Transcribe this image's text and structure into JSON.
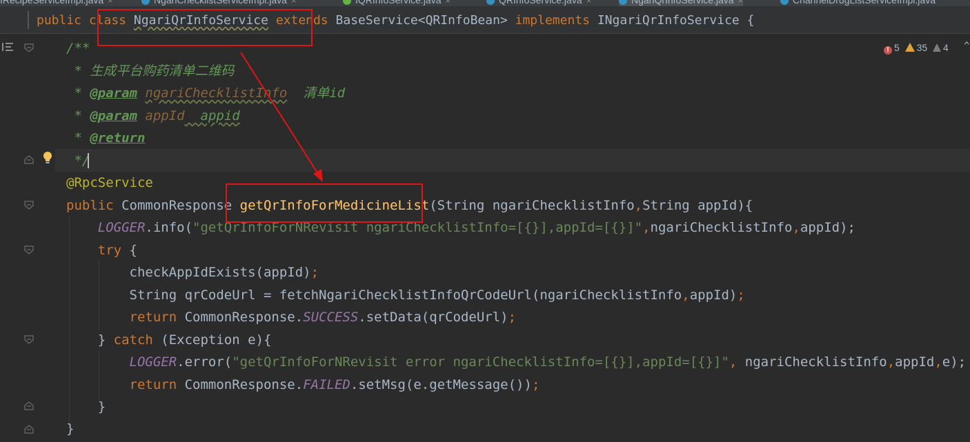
{
  "tabs": [
    {
      "label": "IRecipeServiceImpl.java",
      "icon": "class-icon",
      "closable": true
    },
    {
      "label": "NgariChecklistServiceImpl.java",
      "icon": "class-icon",
      "closable": true
    },
    {
      "label": "IQRInfoService.java",
      "icon": "interface-icon",
      "closable": true
    },
    {
      "label": "QRInfoService.java",
      "icon": "class-icon",
      "closable": true
    },
    {
      "label": "NgariQrInfoService.java",
      "icon": "class-icon",
      "closable": true,
      "active": true
    },
    {
      "label": "ChannelDrugListServiceImpl.java",
      "icon": "class-icon",
      "closable": false
    }
  ],
  "tab_close": "×",
  "sticky": {
    "kw_public": "public",
    "kw_class": "class",
    "class_name": "NgariQrInfoService",
    "kw_extends": "extends",
    "base": "BaseService<QRInfoBean>",
    "kw_implements": "implements",
    "iface": "INgariQrInfoService",
    "brace": "{"
  },
  "inspections": {
    "errors": "5",
    "warnings": "35",
    "weak": "4",
    "chevron": "^"
  },
  "code": {
    "l1": "/**",
    "l2": " * 生成平台购药清单二维码",
    "l3_star": " * ",
    "l3_tag": "@param",
    "l3_name": "ngariChecklistInfo",
    "l3_desc": "  清单id",
    "l4_star": " * ",
    "l4_tag": "@param",
    "l4_name": "appId",
    "l4_desc": "  appid",
    "l5_star": " * ",
    "l5_tag": "@return",
    "l6": " */",
    "l7": "@RpcService",
    "l8_public": "public",
    "l8_type": " CommonResponse ",
    "l8_method": "getQrInfoForMedicineList",
    "l8_params": "(String ngariChecklistInfo",
    "l8_comma": ",",
    "l8_params2": "String appId){",
    "l9_logger": "LOGGER",
    "l9_call": ".info(",
    "l9_str": "\"getQrInfoForNRevisit ngariChecklistInfo=[{}],appId=[{}]\"",
    "l9_comma": ",",
    "l9_arg1": "ngariChecklistInfo",
    "l9_arg2": "appId);",
    "l10_try": "try",
    "l10_brace": " {",
    "l11": "checkAppIdExists(appId)",
    "l12_a": "String qrCodeUrl = fetchNgariChecklistInfoQrCodeUrl(ngariChecklistInfo",
    "l12_b": "appId)",
    "l13_return": "return",
    "l13_type": " CommonResponse.",
    "l13_const": "SUCCESS",
    "l13_rest": ".setData(qrCodeUrl)",
    "l14_close": "} ",
    "l14_catch": "catch",
    "l14_rest": " (Exception e){",
    "l15_logger": "LOGGER",
    "l15_call": ".error(",
    "l15_str": "\"getQrInfoForNRevisit error ngariChecklistInfo=[{}],appId=[{}]\"",
    "l15_arg1": " ngariChecklistInfo",
    "l15_arg2": "appId",
    "l15_arg3": "e);",
    "l16_return": "return",
    "l16_type": " CommonResponse.",
    "l16_const": "FAILED",
    "l16_rest": ".setMsg(e.getMessage())",
    "l17": "}",
    "l18": "}",
    "semicolon": ";"
  },
  "colors": {
    "background": "#2b2b2b",
    "keyword": "#cc7832",
    "method": "#ffc66d",
    "string": "#6a8759",
    "annotation": "#bbb529",
    "constant": "#9876aa",
    "doc": "#629755",
    "highlight_box": "#e01515"
  }
}
